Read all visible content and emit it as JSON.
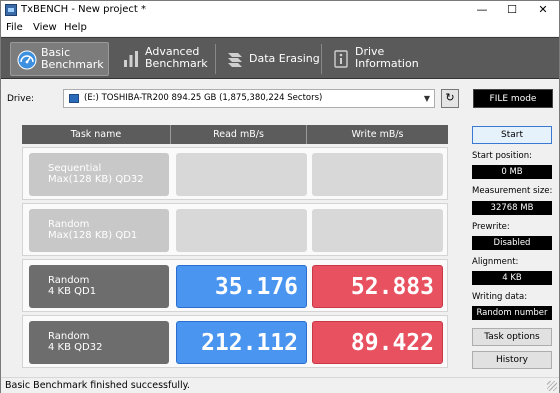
{
  "window": {
    "title": "TxBENCH - New project *",
    "controls": {
      "minimize": "—",
      "maximize": "☐",
      "close": "✕"
    }
  },
  "menu": {
    "items": [
      "File",
      "View",
      "Help"
    ]
  },
  "tabs": [
    {
      "label": "Basic\nBenchmark",
      "icon": "speedometer-icon",
      "active": true
    },
    {
      "label": "Advanced\nBenchmark",
      "icon": "bar-chart-icon",
      "active": false
    },
    {
      "label": "Data Erasing",
      "icon": "erase-icon",
      "active": false
    },
    {
      "label": "Drive\nInformation",
      "icon": "info-icon",
      "active": false
    }
  ],
  "drive": {
    "label": "Drive:",
    "selected": "(E:) TOSHIBA-TR200  894.25 GB (1,875,380,224 Sectors)",
    "refresh_icon": "refresh-icon",
    "mode_label": "FILE mode"
  },
  "table": {
    "headers": [
      "Task name",
      "Read mB/s",
      "Write mB/s"
    ],
    "rows": [
      {
        "task": "Sequential\nMax(128 KB) QD32",
        "read": "",
        "write": "",
        "done": false
      },
      {
        "task": "Random\nMax(128 KB) QD1",
        "read": "",
        "write": "",
        "done": false
      },
      {
        "task": "Random\n4 KB QD1",
        "read": "35.176",
        "write": "52.883",
        "done": true
      },
      {
        "task": "Random\n4 KB QD32",
        "read": "212.112",
        "write": "89.422",
        "done": true
      }
    ]
  },
  "side": {
    "start_label": "Start",
    "start_position_label": "Start position:",
    "start_position": "0 MB",
    "measurement_size_label": "Measurement size:",
    "measurement_size": "32768 MB",
    "prewrite_label": "Prewrite:",
    "prewrite": "Disabled",
    "alignment_label": "Alignment:",
    "alignment": "4 KB",
    "writing_data_label": "Writing data:",
    "writing_data": "Random number",
    "task_options_label": "Task options",
    "history_label": "History"
  },
  "status": {
    "text": "Basic Benchmark finished successfully."
  },
  "colors": {
    "read": "#4a95f0",
    "write": "#e8515f",
    "tabbar": "#5a5a5a"
  }
}
